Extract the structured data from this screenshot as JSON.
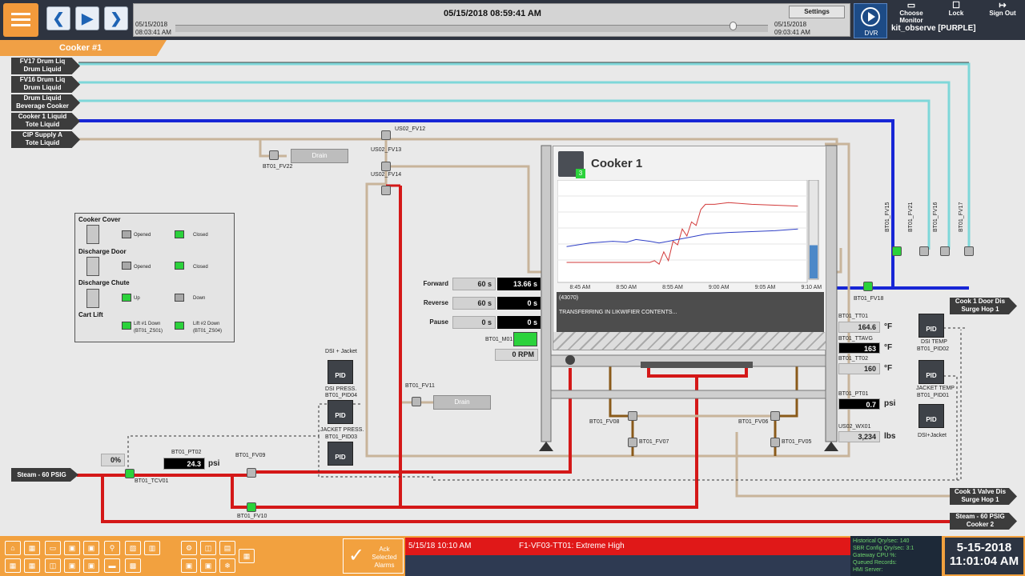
{
  "topbar": {
    "start_date": "05/15/2018",
    "start_time": "08:03:41 AM",
    "current_timestamp": "05/15/2018 08:59:41 AM",
    "end_date": "05/15/2018",
    "end_time": "09:03:41 AM",
    "settings_label": "Settings",
    "dvr_label": "DVR",
    "choose_monitor_label": "Choose Monitor",
    "lock_label": "Lock",
    "sign_out_label": "Sign Out",
    "user_label": "kit_observe [PURPLE]",
    "playback_position": 0.94
  },
  "screen_title": "Cooker #1",
  "flags_left": [
    {
      "line1": "FV17 Drum Liq",
      "line2": "Drum Liquid"
    },
    {
      "line1": "FV16 Drum Liq",
      "line2": "Drum Liquid"
    },
    {
      "line1": "Drum Liquid",
      "line2": "Beverage Cooker"
    },
    {
      "line1": "Cooker 1 Liquid",
      "line2": "Tote Liquid"
    },
    {
      "line1": "CIP Supply A",
      "line2": "Tote Liquid"
    }
  ],
  "flags_right": {
    "door_line1": "Cook 1 Door Dis",
    "door_line2": "Surge Hop 1",
    "valve_line1": "Cook 1 Valve Dis",
    "valve_line2": "Surge Hop 1",
    "steam_line1": "Steam - 60 PSIG",
    "steam_line2": "Cooker 2"
  },
  "steam_input_label": "Steam - 60 PSIG",
  "tags": {
    "us02_fv12": "US02_FV12",
    "us02_fv13": "US02_FV13",
    "us02_fv14": "US02_FV14",
    "bt01_fv22": "BT01_FV22",
    "drain": "Drain",
    "bt01_fv11": "BT01_FV11",
    "bt01_fv09": "BT01_FV09",
    "bt01_fv10": "BT01_FV10",
    "bt01_tcv01": "BT01_TCV01",
    "bt01_pt02": "BT01_PT02",
    "bt01_fv08": "BT01_FV08",
    "bt01_fv07": "BT01_FV07",
    "bt01_fv06": "BT01_FV06",
    "bt01_fv05": "BT01_FV05",
    "bt01_fv18": "BT01_FV18",
    "bt01_fv15": "BT01_FV15",
    "bt01_fv21": "BT01_FV21",
    "bt01_fv16": "BT01_FV16",
    "bt01_fv17": "BT01_FV17",
    "bt01_m01": "BT01_M01"
  },
  "legend": {
    "cover": "Cooker Cover",
    "door": "Discharge Door",
    "chute": "Discharge Chute",
    "lift": "Cart Lift",
    "opened": "Opened",
    "closed": "Closed",
    "up": "Up",
    "down": "Down",
    "lift1": "Lift #1 Down",
    "lift1_tag": "(BT01_ZS01)",
    "lift2": "Lift #2 Down",
    "lift2_tag": "(BT01_ZS04)"
  },
  "motor": {
    "forward_label": "Forward",
    "forward_set": "60 s",
    "forward_val": "13.66 s",
    "reverse_label": "Reverse",
    "reverse_set": "60 s",
    "reverse_val": "0 s",
    "pause_label": "Pause",
    "pause_set": "0 s",
    "pause_val": "0 s",
    "rpm": "0 RPM"
  },
  "pid": {
    "dsi_jacket_top": "DSI + Jacket",
    "dsi_press": "DSI PRESS.",
    "dsi_press_tag": "BT01_PID04",
    "jacket_press": "JACKET PRESS.",
    "jacket_press_tag": "BT01_PID03",
    "dsi_temp": "DSI TEMP",
    "dsi_temp_tag": "BT01_PID02",
    "jacket_temp": "JACKET TEMP",
    "jacket_temp_tag": "BT01_PID01",
    "dsi_jacket": "DSI+Jacket",
    "icon_text": "PID"
  },
  "readings": {
    "tcv_pct": "0%",
    "pt02_val": "24.3",
    "pt02_unit": "psi",
    "tt01_label": "BT01_TT01",
    "tt01_val": "164.6",
    "tt01_unit": "°F",
    "ttavg_label": "BT01_TTAVG",
    "ttavg_val": "163",
    "ttavg_unit": "°F",
    "tt02_label": "BT01_TT02",
    "tt02_val": "160",
    "tt02_unit": "°F",
    "pt01_label": "BT01_PT01",
    "pt01_val": "0.7",
    "pt01_unit": "psi",
    "wx01_label": "US02_WX01",
    "wx01_val": "3,234",
    "wx01_unit": "lbs"
  },
  "popup": {
    "title": "Cooker 1",
    "badge": "3",
    "msg_code": "(43070)",
    "msg_text": "TRANSFERRING IN LIKWIFIER CONTENTS..."
  },
  "chart_data": {
    "type": "line",
    "x_ticks": [
      "8:45 AM",
      "8:50 AM",
      "8:55 AM",
      "9:00 AM",
      "9:05 AM",
      "9:10 AM"
    ],
    "series": [
      {
        "color": "#d23a3a",
        "x": [
          0,
          5,
          10,
          15,
          18,
          19,
          20,
          21,
          22,
          23,
          24,
          25,
          26,
          27,
          28,
          29,
          30,
          32,
          35,
          40,
          45,
          50
        ],
        "y": [
          10,
          10,
          10,
          10,
          10,
          12,
          8,
          22,
          12,
          34,
          30,
          48,
          40,
          56,
          52,
          70,
          76,
          76,
          78,
          76,
          75,
          74
        ]
      },
      {
        "color": "#2f3fc6",
        "x": [
          0,
          5,
          10,
          13,
          15,
          18,
          20,
          22,
          24,
          26,
          28,
          30,
          32,
          35,
          40,
          45,
          50
        ],
        "y": [
          28,
          32,
          34,
          33,
          36,
          34,
          32,
          34,
          36,
          38,
          40,
          42,
          43,
          44,
          45,
          46,
          48
        ]
      }
    ],
    "x_range": [
      -2,
      52
    ],
    "y_range": [
      0,
      100
    ],
    "level_bar_fraction": 0.34
  },
  "footer": {
    "ack_label": "Ack Selected Alarms",
    "alarm_time": "5/15/18 10:10 AM",
    "alarm_text": "F1-VF03-TT01: Extreme High",
    "status_lines": [
      "Historical Qry/sec: 140",
      "SBR Config Qry/sec: 3:1",
      "Gateway CPU %:",
      "Queued Records:",
      "HMI Server:"
    ],
    "date": "5-15-2018",
    "time": "11:01:04 AM"
  },
  "colors": {
    "orange": "#f2a13f",
    "blue_pipe": "#1726d6",
    "cyan_pipe": "#7ed7d9",
    "red_pipe": "#d41818",
    "tan_pipe": "#c8b49a",
    "green": "#2bd23b"
  }
}
